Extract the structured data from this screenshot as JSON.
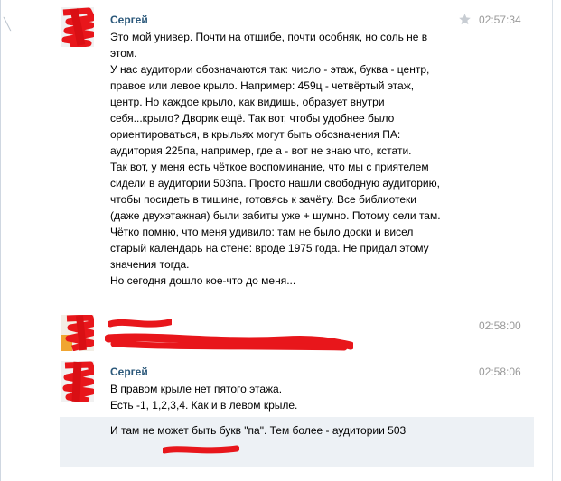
{
  "messages": [
    {
      "author": "Сергей",
      "time": "02:57:34",
      "starred": false,
      "lines": [
        "Это мой универ. Почти на отшибе, почти особняк, но соль не в",
        "этом.",
        "У нас аудитории обозначаются так: число - этаж, буква - центр,",
        "правое или левое крыло. Например: 459ц - четвёртый этаж,",
        "центр. Но каждое крыло, как видишь, образует внутри",
        "себя...крыло? Дворик ещё. Так вот, чтобы удобнее было",
        "ориентироваться, в крыльях могут быть обозначения ПА:",
        "аудитория 225па, например, где а - вот не знаю что, кстати.",
        "Так вот, у меня есть чёткое воспоминание, что мы с приятелем",
        "сидели в аудитории 503па. Просто нашли свободную аудиторию,",
        "чтобы посидеть в тишине, готовясь к зачёту. Все библиотеки",
        "(даже двухэтажная) были забиты уже + шумно. Потому сели там.",
        "Чётко помню, что меня удивило: там не было доски и висел",
        "старый календарь на стене: вроде 1975 года. Не придал этому",
        "значения тогда.",
        "Но сегодня дошло кое-что до меня..."
      ]
    },
    {
      "author": "",
      "time": "02:58:00",
      "redacted": true
    },
    {
      "author": "Сергей",
      "time": "02:58:06",
      "lines": [
        "В правом крыле нет пятого этажа.",
        "Есть -1, 1,2,3,4. Как и в левом крыле."
      ]
    },
    {
      "highlighted": true,
      "lines": [
        "И там не может быть букв \"па\". Тем более - аудитории 503"
      ],
      "redacted_author": true
    }
  ],
  "colors": {
    "author_link": "#2b587a",
    "timestamp": "#999999",
    "highlight_bg": "#edf1f5",
    "redaction": "#e8161b",
    "star": "#c8cdd3"
  },
  "icons": {
    "star": "star-icon",
    "close": "close-icon"
  }
}
